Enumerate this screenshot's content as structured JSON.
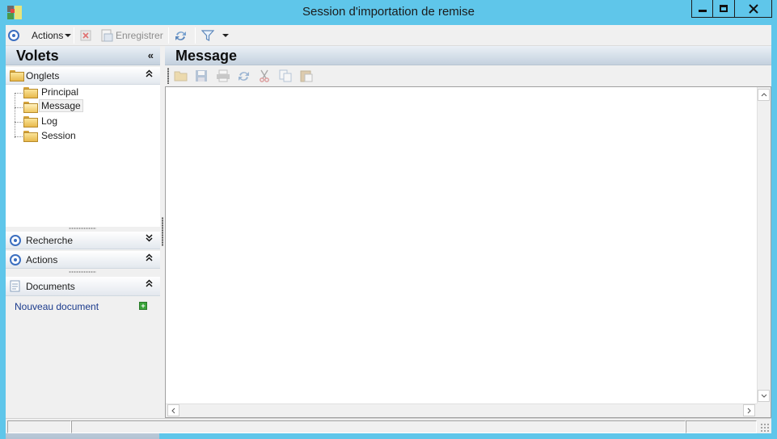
{
  "window": {
    "title": "Session d'importation de remise",
    "minimize_glyph": "‒",
    "maximize_glyph": "□",
    "close_glyph": "✕"
  },
  "toolbar": {
    "actions_label": "Actions",
    "save_label": "Enregistrer",
    "actions_icon": "radio-target-icon",
    "delete_icon": "delete-icon",
    "save_icon": "save-icon",
    "refresh_icon": "refresh-icon",
    "filter_icon": "filter-icon"
  },
  "left_pane": {
    "title": "Volets",
    "collapse_glyph": "«",
    "sections": {
      "tabs": {
        "label": "Onglets",
        "chevron": "⌃"
      },
      "search": {
        "label": "Recherche",
        "chevron": "⌄"
      },
      "actions": {
        "label": "Actions",
        "chevron": "⌃"
      },
      "documents": {
        "label": "Documents",
        "chevron": "⌃"
      }
    },
    "tree_items": [
      "Principal",
      "Message",
      "Log",
      "Session"
    ],
    "selected_tree_item": "Message",
    "new_document_link": "Nouveau document",
    "bottom_chevron": "▾"
  },
  "right_pane": {
    "title": "Message",
    "toolbar_icons": [
      "open-folder-icon",
      "save-icon",
      "print-icon",
      "refresh-icon",
      "cut-icon",
      "copy-icon",
      "paste-icon"
    ]
  },
  "colors": {
    "titlebar": "#5fc6ea",
    "header_gradient_top": "#eaf0f6",
    "header_gradient_bottom": "#c4d1de",
    "link": "#1a3a8c",
    "accent": "#3c6fc0"
  }
}
